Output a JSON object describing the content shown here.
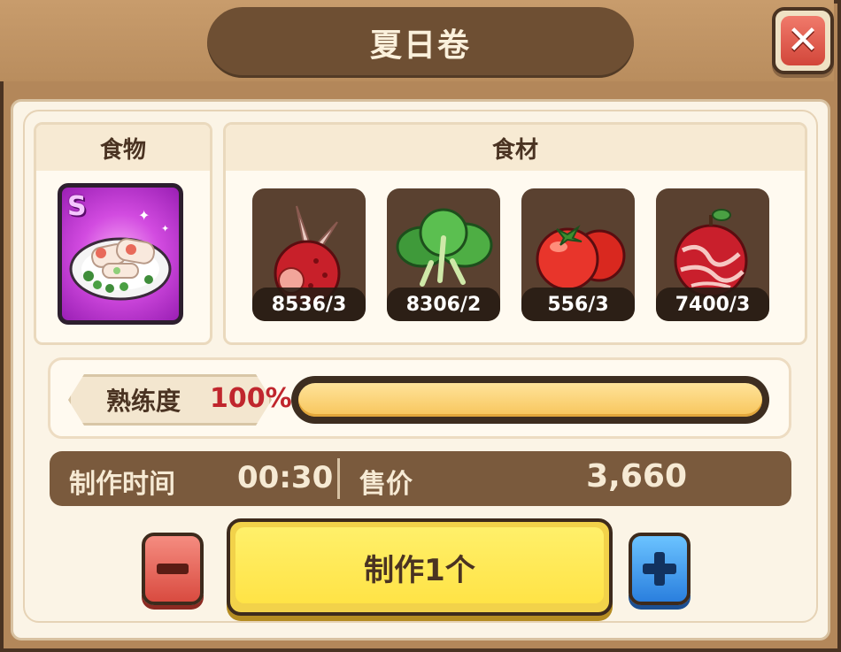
{
  "dialog": {
    "title": "夏日卷",
    "close_icon": "close-x-icon"
  },
  "food": {
    "header": "食物",
    "rank": "S",
    "icon": "summer-roll-dish-icon",
    "card_color": "#d24be0"
  },
  "ingredients": {
    "header": "食材",
    "items": [
      {
        "icon": "red-radish-icon",
        "count": "8536/3"
      },
      {
        "icon": "leafy-greens-icon",
        "count": "8306/2"
      },
      {
        "icon": "tomato-icon",
        "count": "556/3"
      },
      {
        "icon": "marbled-meat-apple-icon",
        "count": "7400/3"
      }
    ]
  },
  "mastery": {
    "label": "熟练度",
    "percent_text": "100%",
    "progress": 1.0
  },
  "info": {
    "time_label": "制作时间",
    "time_value": "00:30",
    "price_label": "售价",
    "price_value": "3,660"
  },
  "actions": {
    "minus_icon": "minus-icon",
    "make_label": "制作1个",
    "plus_icon": "plus-icon"
  },
  "colors": {
    "frame": "#b3875a",
    "title_pill": "#6e4f33",
    "accent_red": "#c0262d",
    "progress": "#f7c55b",
    "button_yellow": "#ffe346",
    "button_blue": "#2a7fde",
    "button_red": "#d94b40"
  }
}
